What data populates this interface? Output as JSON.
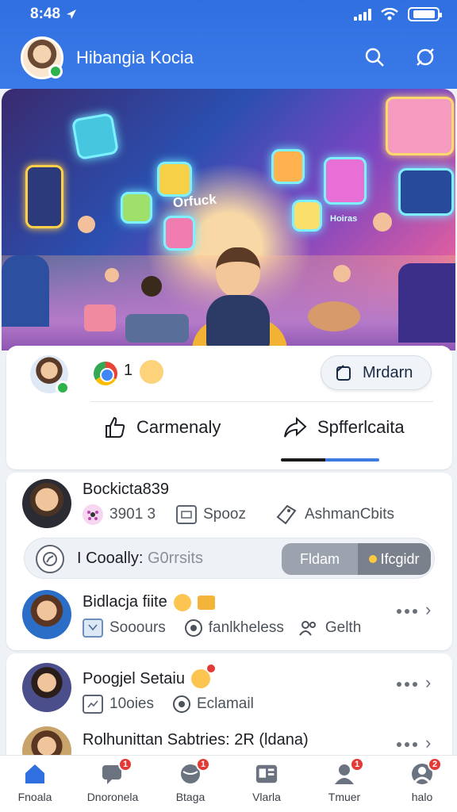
{
  "status_bar": {
    "time": "8:48",
    "battery_level": 0.8
  },
  "header": {
    "title": "Hibangia Kocia",
    "accent": "#2f6fe0"
  },
  "hero": {
    "caption": "Orfuck",
    "badge_text": "Hoiras"
  },
  "post": {
    "reaction_count": "1",
    "action_button": "Mrdarn",
    "actions": [
      {
        "label": "Carmenaly",
        "icon": "thumbs-up-icon"
      },
      {
        "label": "Spfferlcaita",
        "icon": "share-icon"
      }
    ]
  },
  "list1": {
    "title": "Bockicta839",
    "meta": [
      {
        "icon": "flower-icon",
        "label": "3901 3"
      },
      {
        "icon": "calendar-icon",
        "label": "Spooz"
      },
      {
        "icon": "tag-icon",
        "label": "AshmanCbits"
      }
    ]
  },
  "search_bar": {
    "label": "I Cooally:",
    "placeholder": "G0rrsits",
    "btn1": "Fldam",
    "btn2": "Ifcgidr"
  },
  "list2": {
    "title": "Bidlacja fiite",
    "meta": [
      {
        "icon": "box-icon",
        "label": "Sooours"
      },
      {
        "icon": "pin-icon",
        "label": "fanlkheless"
      },
      {
        "icon": "users-icon",
        "label": "Gelth"
      }
    ]
  },
  "list3": {
    "title": "Poogjel Setaiu",
    "meta": [
      {
        "icon": "image-icon",
        "label": "10oies"
      },
      {
        "icon": "pin-icon",
        "label": "Eclamail"
      }
    ]
  },
  "list4": {
    "title": "Rolhunittan Sabtries: 2R (ldana)"
  },
  "bottom_nav": [
    {
      "label": "Fnoala",
      "icon": "home-icon",
      "badge": ""
    },
    {
      "label": "Dnoronela",
      "icon": "chat-icon",
      "badge": "1"
    },
    {
      "label": "Btaga",
      "icon": "globe-icon",
      "badge": "1"
    },
    {
      "label": "Vlarla",
      "icon": "contacts-icon",
      "badge": ""
    },
    {
      "label": "Tmuer",
      "icon": "profile-icon",
      "badge": "1"
    },
    {
      "label": "halo",
      "icon": "account-icon",
      "badge": "2"
    }
  ]
}
